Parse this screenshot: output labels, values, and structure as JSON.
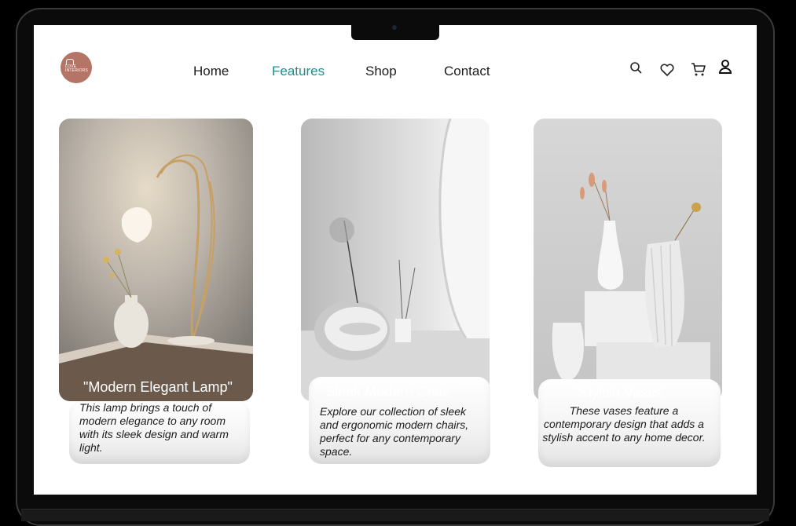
{
  "brand": {
    "logo_text_1": "LOVE",
    "logo_text_2": "INTERIORS"
  },
  "nav": {
    "items": [
      "Home",
      "Features",
      "Shop",
      "Contact"
    ],
    "active": "Features"
  },
  "header_icons": [
    "search-icon",
    "heart-icon",
    "cart-icon",
    "user-icon"
  ],
  "colors": {
    "accent": "#1b8f8f",
    "logo_bg": "#b47466",
    "text": "#1c1c1c"
  },
  "cards": [
    {
      "title": "\"Modern Elegant Lamp\"",
      "description": "This lamp brings a touch of modern elegance to any room with its sleek design and warm light."
    },
    {
      "title": "\"Sleek Modern Chair\"",
      "description": "Explore our collection of sleek and ergonomic modern chairs, perfect for any contemporary space."
    },
    {
      "title": "\"Stylish Vases\"",
      "description": "These vases feature a contemporary design that adds a stylish accent to any home decor."
    }
  ]
}
